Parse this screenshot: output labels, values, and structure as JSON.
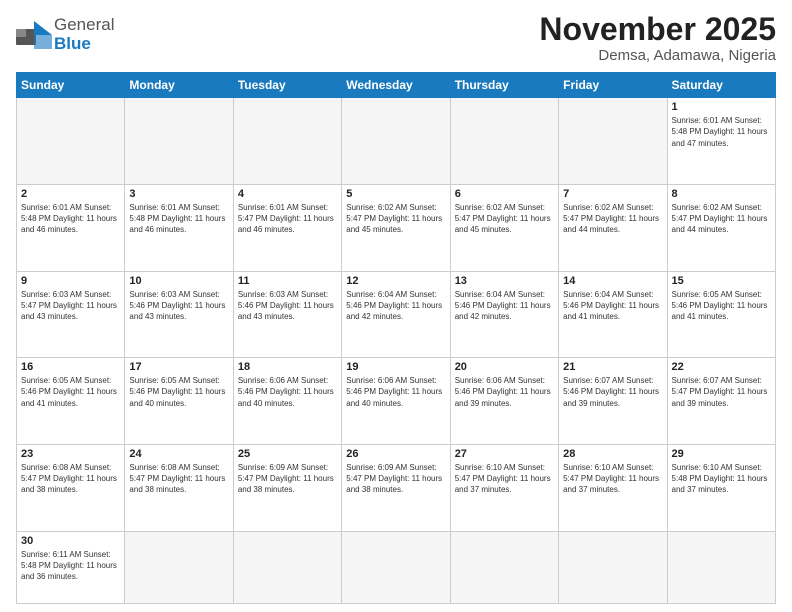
{
  "logo": {
    "text_general": "General",
    "text_blue": "Blue"
  },
  "header": {
    "month_title": "November 2025",
    "location": "Demsa, Adamawa, Nigeria"
  },
  "days_of_week": [
    "Sunday",
    "Monday",
    "Tuesday",
    "Wednesday",
    "Thursday",
    "Friday",
    "Saturday"
  ],
  "weeks": [
    {
      "days": [
        {
          "number": "",
          "info": ""
        },
        {
          "number": "",
          "info": ""
        },
        {
          "number": "",
          "info": ""
        },
        {
          "number": "",
          "info": ""
        },
        {
          "number": "",
          "info": ""
        },
        {
          "number": "",
          "info": ""
        },
        {
          "number": "1",
          "info": "Sunrise: 6:01 AM\nSunset: 5:48 PM\nDaylight: 11 hours\nand 47 minutes."
        }
      ]
    },
    {
      "days": [
        {
          "number": "2",
          "info": "Sunrise: 6:01 AM\nSunset: 5:48 PM\nDaylight: 11 hours\nand 46 minutes."
        },
        {
          "number": "3",
          "info": "Sunrise: 6:01 AM\nSunset: 5:48 PM\nDaylight: 11 hours\nand 46 minutes."
        },
        {
          "number": "4",
          "info": "Sunrise: 6:01 AM\nSunset: 5:47 PM\nDaylight: 11 hours\nand 46 minutes."
        },
        {
          "number": "5",
          "info": "Sunrise: 6:02 AM\nSunset: 5:47 PM\nDaylight: 11 hours\nand 45 minutes."
        },
        {
          "number": "6",
          "info": "Sunrise: 6:02 AM\nSunset: 5:47 PM\nDaylight: 11 hours\nand 45 minutes."
        },
        {
          "number": "7",
          "info": "Sunrise: 6:02 AM\nSunset: 5:47 PM\nDaylight: 11 hours\nand 44 minutes."
        },
        {
          "number": "8",
          "info": "Sunrise: 6:02 AM\nSunset: 5:47 PM\nDaylight: 11 hours\nand 44 minutes."
        }
      ]
    },
    {
      "days": [
        {
          "number": "9",
          "info": "Sunrise: 6:03 AM\nSunset: 5:47 PM\nDaylight: 11 hours\nand 43 minutes."
        },
        {
          "number": "10",
          "info": "Sunrise: 6:03 AM\nSunset: 5:46 PM\nDaylight: 11 hours\nand 43 minutes."
        },
        {
          "number": "11",
          "info": "Sunrise: 6:03 AM\nSunset: 5:46 PM\nDaylight: 11 hours\nand 43 minutes."
        },
        {
          "number": "12",
          "info": "Sunrise: 6:04 AM\nSunset: 5:46 PM\nDaylight: 11 hours\nand 42 minutes."
        },
        {
          "number": "13",
          "info": "Sunrise: 6:04 AM\nSunset: 5:46 PM\nDaylight: 11 hours\nand 42 minutes."
        },
        {
          "number": "14",
          "info": "Sunrise: 6:04 AM\nSunset: 5:46 PM\nDaylight: 11 hours\nand 41 minutes."
        },
        {
          "number": "15",
          "info": "Sunrise: 6:05 AM\nSunset: 5:46 PM\nDaylight: 11 hours\nand 41 minutes."
        }
      ]
    },
    {
      "days": [
        {
          "number": "16",
          "info": "Sunrise: 6:05 AM\nSunset: 5:46 PM\nDaylight: 11 hours\nand 41 minutes."
        },
        {
          "number": "17",
          "info": "Sunrise: 6:05 AM\nSunset: 5:46 PM\nDaylight: 11 hours\nand 40 minutes."
        },
        {
          "number": "18",
          "info": "Sunrise: 6:06 AM\nSunset: 5:46 PM\nDaylight: 11 hours\nand 40 minutes."
        },
        {
          "number": "19",
          "info": "Sunrise: 6:06 AM\nSunset: 5:46 PM\nDaylight: 11 hours\nand 40 minutes."
        },
        {
          "number": "20",
          "info": "Sunrise: 6:06 AM\nSunset: 5:46 PM\nDaylight: 11 hours\nand 39 minutes."
        },
        {
          "number": "21",
          "info": "Sunrise: 6:07 AM\nSunset: 5:46 PM\nDaylight: 11 hours\nand 39 minutes."
        },
        {
          "number": "22",
          "info": "Sunrise: 6:07 AM\nSunset: 5:47 PM\nDaylight: 11 hours\nand 39 minutes."
        }
      ]
    },
    {
      "days": [
        {
          "number": "23",
          "info": "Sunrise: 6:08 AM\nSunset: 5:47 PM\nDaylight: 11 hours\nand 38 minutes."
        },
        {
          "number": "24",
          "info": "Sunrise: 6:08 AM\nSunset: 5:47 PM\nDaylight: 11 hours\nand 38 minutes."
        },
        {
          "number": "25",
          "info": "Sunrise: 6:09 AM\nSunset: 5:47 PM\nDaylight: 11 hours\nand 38 minutes."
        },
        {
          "number": "26",
          "info": "Sunrise: 6:09 AM\nSunset: 5:47 PM\nDaylight: 11 hours\nand 38 minutes."
        },
        {
          "number": "27",
          "info": "Sunrise: 6:10 AM\nSunset: 5:47 PM\nDaylight: 11 hours\nand 37 minutes."
        },
        {
          "number": "28",
          "info": "Sunrise: 6:10 AM\nSunset: 5:47 PM\nDaylight: 11 hours\nand 37 minutes."
        },
        {
          "number": "29",
          "info": "Sunrise: 6:10 AM\nSunset: 5:48 PM\nDaylight: 11 hours\nand 37 minutes."
        }
      ]
    },
    {
      "days": [
        {
          "number": "30",
          "info": "Sunrise: 6:11 AM\nSunset: 5:48 PM\nDaylight: 11 hours\nand 36 minutes."
        },
        {
          "number": "",
          "info": ""
        },
        {
          "number": "",
          "info": ""
        },
        {
          "number": "",
          "info": ""
        },
        {
          "number": "",
          "info": ""
        },
        {
          "number": "",
          "info": ""
        },
        {
          "number": "",
          "info": ""
        }
      ]
    }
  ]
}
